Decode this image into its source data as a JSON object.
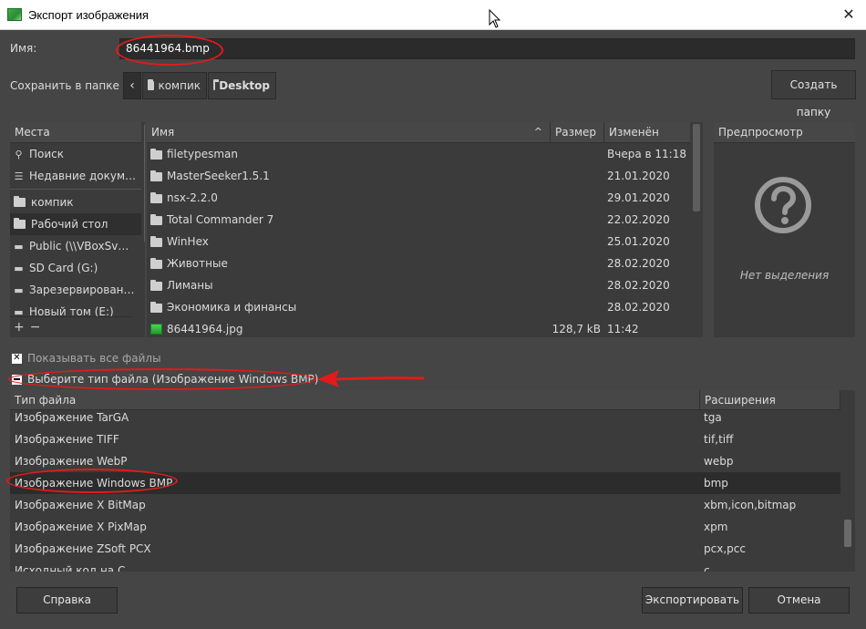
{
  "window": {
    "title": "Экспорт изображения",
    "close_glyph": "✕",
    "icon": "gimp-icon"
  },
  "name_row": {
    "label": "Имя:",
    "value": "86441964.bmp"
  },
  "save_row": {
    "label": "Сохранить в папке",
    "back_glyph": "‹",
    "crumbs": [
      {
        "label": "компик"
      },
      {
        "label": "Desktop"
      }
    ],
    "create_folder_label": "Создать папку"
  },
  "places": {
    "header": "Места",
    "items": [
      {
        "label": "Поиск",
        "icon": "search-icon"
      },
      {
        "label": "Недавние докум…",
        "icon": "recent-icon"
      },
      {
        "label": "компик",
        "icon": "folder-icon"
      },
      {
        "label": "Рабочий стол",
        "icon": "folder-icon"
      },
      {
        "label": "Public (\\\\VBoxSv…",
        "icon": "network-drive-icon"
      },
      {
        "label": "SD Card (G:)",
        "icon": "drive-icon"
      },
      {
        "label": "Зарезервирован…",
        "icon": "drive-icon"
      },
      {
        "label": "Новый том (E:)",
        "icon": "drive-icon"
      }
    ],
    "add_glyph": "+",
    "remove_glyph": "−"
  },
  "files": {
    "columns": {
      "name": "Имя",
      "size": "Размер",
      "modified": "Изменён"
    },
    "sort_glyph": "^",
    "rows": [
      {
        "name": "filetypesman",
        "size": "",
        "modified": "Вчера в 11:18",
        "type": "folder"
      },
      {
        "name": "MasterSeeker1.5.1",
        "size": "",
        "modified": "21.01.2020",
        "type": "folder"
      },
      {
        "name": "nsx-2.2.0",
        "size": "",
        "modified": "29.01.2020",
        "type": "folder"
      },
      {
        "name": "Total Commander 7",
        "size": "",
        "modified": "22.02.2020",
        "type": "folder"
      },
      {
        "name": "WinHex",
        "size": "",
        "modified": "25.01.2020",
        "type": "folder"
      },
      {
        "name": "Животные",
        "size": "",
        "modified": "28.02.2020",
        "type": "folder"
      },
      {
        "name": "Лиманы",
        "size": "",
        "modified": "28.02.2020",
        "type": "folder"
      },
      {
        "name": "Экономика и финансы",
        "size": "",
        "modified": "28.02.2020",
        "type": "folder"
      },
      {
        "name": "86441964.jpg",
        "size": "128,7 kB",
        "modified": "11:42",
        "type": "image"
      }
    ]
  },
  "preview": {
    "header": "Предпросмотр",
    "empty_text": "Нет выделения",
    "icon": "question-icon"
  },
  "show_all_files": {
    "label": "Показывать все файлы",
    "mark": "✕"
  },
  "file_type_toggle": {
    "label": "Выберите тип файла (Изображение Windows BMP)"
  },
  "file_types": {
    "columns": {
      "type": "Тип файла",
      "ext": "Расширения"
    },
    "rows": [
      {
        "type": "Изображение TarGA",
        "ext": "tga"
      },
      {
        "type": "Изображение TIFF",
        "ext": "tif,tiff"
      },
      {
        "type": "Изображение WebP",
        "ext": "webp"
      },
      {
        "type": "Изображение Windows BMP",
        "ext": "bmp"
      },
      {
        "type": "Изображение X BitMap",
        "ext": "xbm,icon,bitmap"
      },
      {
        "type": "Изображение X PixMap",
        "ext": "xpm"
      },
      {
        "type": "Изображение ZSoft PCX",
        "ext": "pcx,pcc"
      },
      {
        "type": "Исходный код на C",
        "ext": "c"
      }
    ],
    "selected_index": 3
  },
  "buttons": {
    "help": "Справка",
    "export": "Экспортировать",
    "cancel": "Отмена"
  },
  "colors": {
    "annotation": "#e01b1b",
    "background": "#454545"
  }
}
